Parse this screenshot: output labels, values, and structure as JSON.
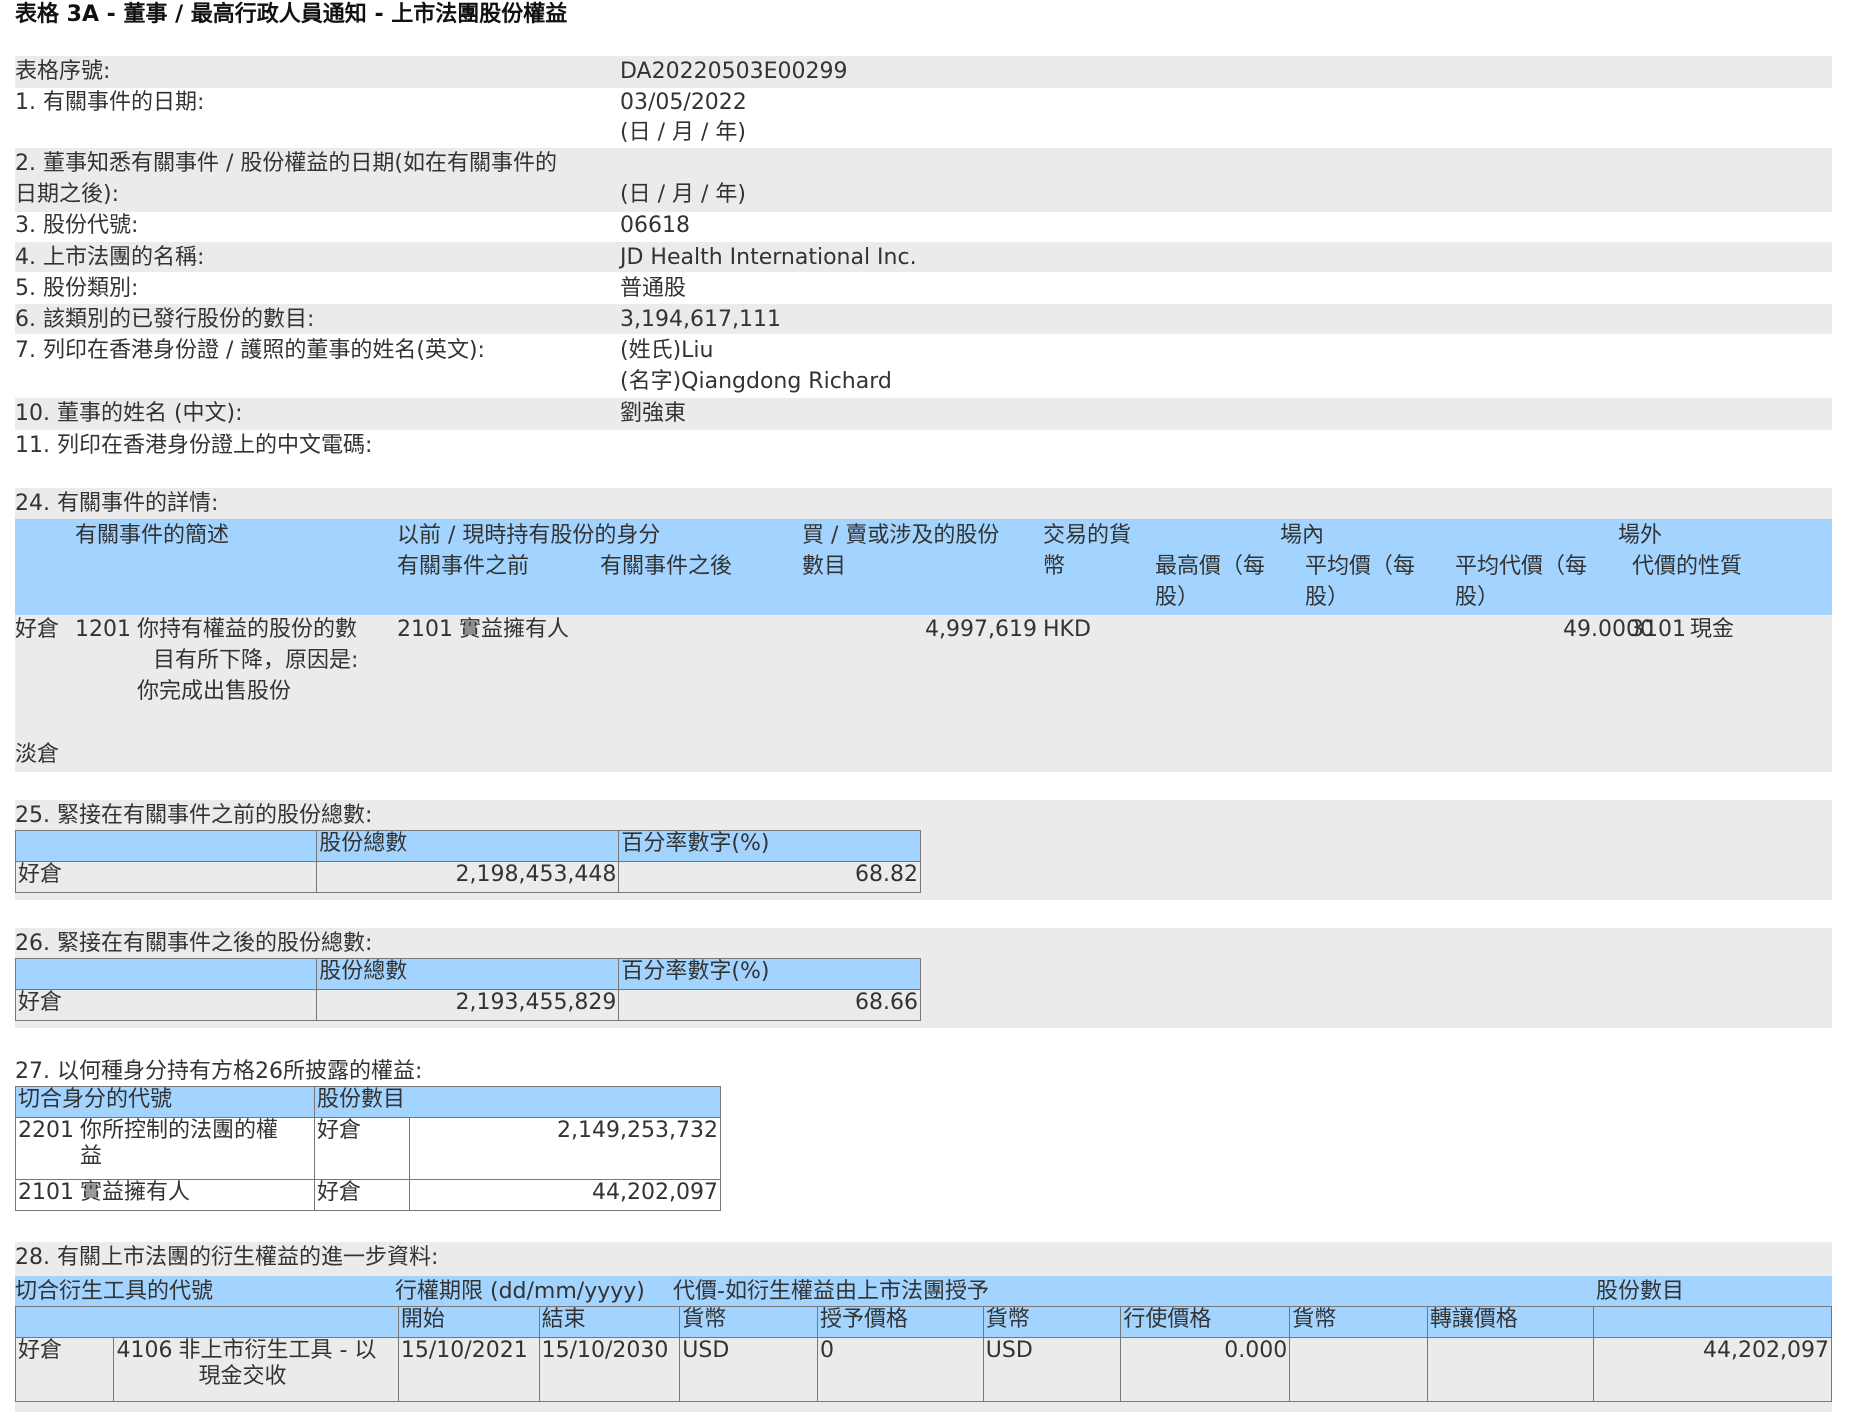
{
  "title": "表格 3A - 董事 / 最高行政人員通知 - 上市法團股份權益",
  "form": {
    "serial_label": "表格序號:",
    "serial_value": "DA20220503E00299",
    "q1_label": "1. 有關事件的日期:",
    "q1_value": "03/05/2022",
    "q1_fmt": "(日 / 月 / 年)",
    "q2_label_l1": "2. 董事知悉有關事件 / 股份權益的日期(如在有關事件的",
    "q2_label_l2": "日期之後):",
    "q2_fmt": "(日 / 月 / 年)",
    "q3_label": "3. 股份代號:",
    "q3_value": "06618",
    "q4_label": "4. 上市法團的名稱:",
    "q4_value": "JD Health International Inc.",
    "q5_label": "5. 股份類別:",
    "q5_value": "普通股",
    "q6_label": "6. 該類別的已發行股份的數目:",
    "q6_value": "3,194,617,111",
    "q7_label": "7. 列印在香港身份證 / 護照的董事的姓名(英文):",
    "q7_surname": "(姓氏)Liu",
    "q7_given": "(名字)Qiangdong Richard",
    "q10_label": "10. 董事的姓名 (中文):",
    "q10_value": "劉強東",
    "q11_label": "11. 列印在香港身份證上的中文電碼:"
  },
  "s24": {
    "label": "24. 有關事件的詳情:",
    "h_desc": "有關事件的簡述",
    "h_capacity": "以前 / 現時持有股份的身分",
    "h_before": "有關事件之前",
    "h_after": "有關事件之後",
    "h_shares_l1": "買 / 賣或涉及的股份",
    "h_shares_l2": "數目",
    "h_currency_l1": "交易的貨",
    "h_currency_l2": "幣",
    "h_onexch": "場內",
    "h_high_l1": "最高價（每",
    "h_high_l2": "股）",
    "h_avg_l1": "平均價（每",
    "h_avg_l2": "股）",
    "h_offexch": "場外",
    "h_avgcons_l1": "平均代價（每",
    "h_avgcons_l2": "股）",
    "h_nature": "代價的性質",
    "row_long": "好倉",
    "code": "1201",
    "desc_l1": "你持有權益的股份的數",
    "desc_l2": "目有所下降，原因是:",
    "desc_l3": "你完成出售股份",
    "cap_code": "2101",
    "cap_text": "實益擁有人",
    "shares": "4,997,619",
    "currency": "HKD",
    "avg_cons": "49.0000",
    "nature_code": "3101",
    "nature_text": "現金",
    "row_short": "淡倉"
  },
  "s25": {
    "label": "25. 緊接在有關事件之前的股份總數:",
    "h_total": "股份總數",
    "h_pct": "百分率數字(%)",
    "row": "好倉",
    "total": "2,198,453,448",
    "pct": "68.82"
  },
  "s26": {
    "label": "26. 緊接在有關事件之後的股份總數:",
    "h_total": "股份總數",
    "h_pct": "百分率數字(%)",
    "row": "好倉",
    "total": "2,193,455,829",
    "pct": "68.66"
  },
  "s27": {
    "label": "27. 以何種身分持有方格26所披露的權益:",
    "h_code": "切合身分的代號",
    "h_shares": "股份數目",
    "rows": [
      {
        "code": "2201",
        "text_l1": "你所控制的法團的權",
        "text_l2": "益",
        "pos": "好倉",
        "shares": "2,149,253,732"
      },
      {
        "code": "2101",
        "text_l1": "實益擁有人",
        "text_l2": "",
        "pos": "好倉",
        "shares": "44,202,097"
      }
    ]
  },
  "s28": {
    "label": "28. 有關上市法團的衍生權益的進一步資料:",
    "h_code": "切合衍生工具的代號",
    "h_period": "行權期限 (dd/mm/yyyy)",
    "h_cons": "代價-如衍生權益由上市法團授予",
    "h_shares": "股份數目",
    "h_start": "開始",
    "h_end": "結束",
    "h_cur1": "貨幣",
    "h_grant": "授予價格",
    "h_cur2": "貨幣",
    "h_exercise": "行使價格",
    "h_cur3": "貨幣",
    "h_transfer": "轉讓價格",
    "row": "好倉",
    "code": "4106",
    "code_text_l1": "非上市衍生工具 - 以",
    "code_text_l2": "現金交收",
    "start": "15/10/2021",
    "end": "15/10/2030",
    "cur1": "USD",
    "grant": "0",
    "cur2": "USD",
    "exercise": "0.000",
    "shares": "44,202,097"
  }
}
